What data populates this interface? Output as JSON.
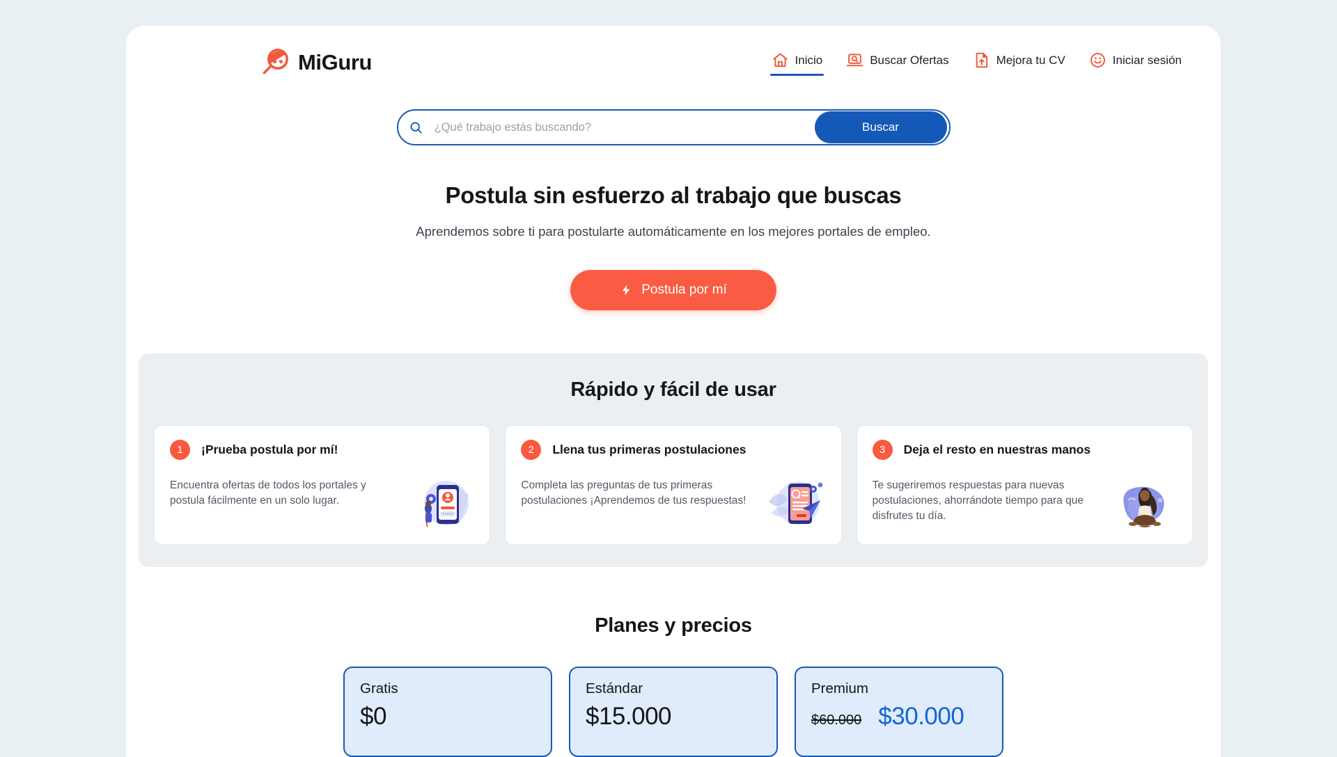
{
  "brand": {
    "name": "MiGuru",
    "logo_icon": "miguru-magnifier-face-logo",
    "accent_color": "#f9593f",
    "primary_color": "#1559b8"
  },
  "nav": {
    "items": [
      {
        "label": "Inicio",
        "icon": "home-icon",
        "active": true
      },
      {
        "label": "Buscar Ofertas",
        "icon": "laptop-search-icon",
        "active": false
      },
      {
        "label": "Mejora tu CV",
        "icon": "document-upload-icon",
        "active": false
      },
      {
        "label": "Iniciar sesión",
        "icon": "smiley-face-icon",
        "active": false
      }
    ]
  },
  "search": {
    "placeholder": "¿Qué trabajo estás buscando?",
    "value": "",
    "button_label": "Buscar",
    "icon": "search-icon"
  },
  "hero": {
    "title": "Postula sin esfuerzo al trabajo que buscas",
    "subtitle": "Aprendemos sobre ti para postularte automáticamente en los mejores portales de empleo.",
    "cta_label": "Postula por mí",
    "cta_icon": "lightning-bolt-icon"
  },
  "steps": {
    "title": "Rápido y fácil de usar",
    "cards": [
      {
        "number": "1",
        "title": "¡Prueba postula por mí!",
        "description": "Encuentra ofertas de todos los portales y postula fácilmente en un solo lugar.",
        "illustration": "phone-profile-illustration"
      },
      {
        "number": "2",
        "title": "Llena tus primeras postulaciones",
        "description": "Completa las preguntas de tus primeras postulaciones ¡Aprendemos de tus respuestas!",
        "illustration": "phone-form-paperplane-illustration"
      },
      {
        "number": "3",
        "title": "Deja el resto en nuestras manos",
        "description": "Te sugeriremos respuestas para nuevas postulaciones, ahorrándote tiempo para que disfrutes tu día.",
        "illustration": "meditating-woman-illustration"
      }
    ]
  },
  "pricing": {
    "title": "Planes y precios",
    "plans": [
      {
        "name": "Gratis",
        "price": "$0",
        "old_price": ""
      },
      {
        "name": "Estándar",
        "price": "$15.000",
        "old_price": ""
      },
      {
        "name": "Premium",
        "price": "$30.000",
        "old_price": "$60.000"
      }
    ]
  }
}
